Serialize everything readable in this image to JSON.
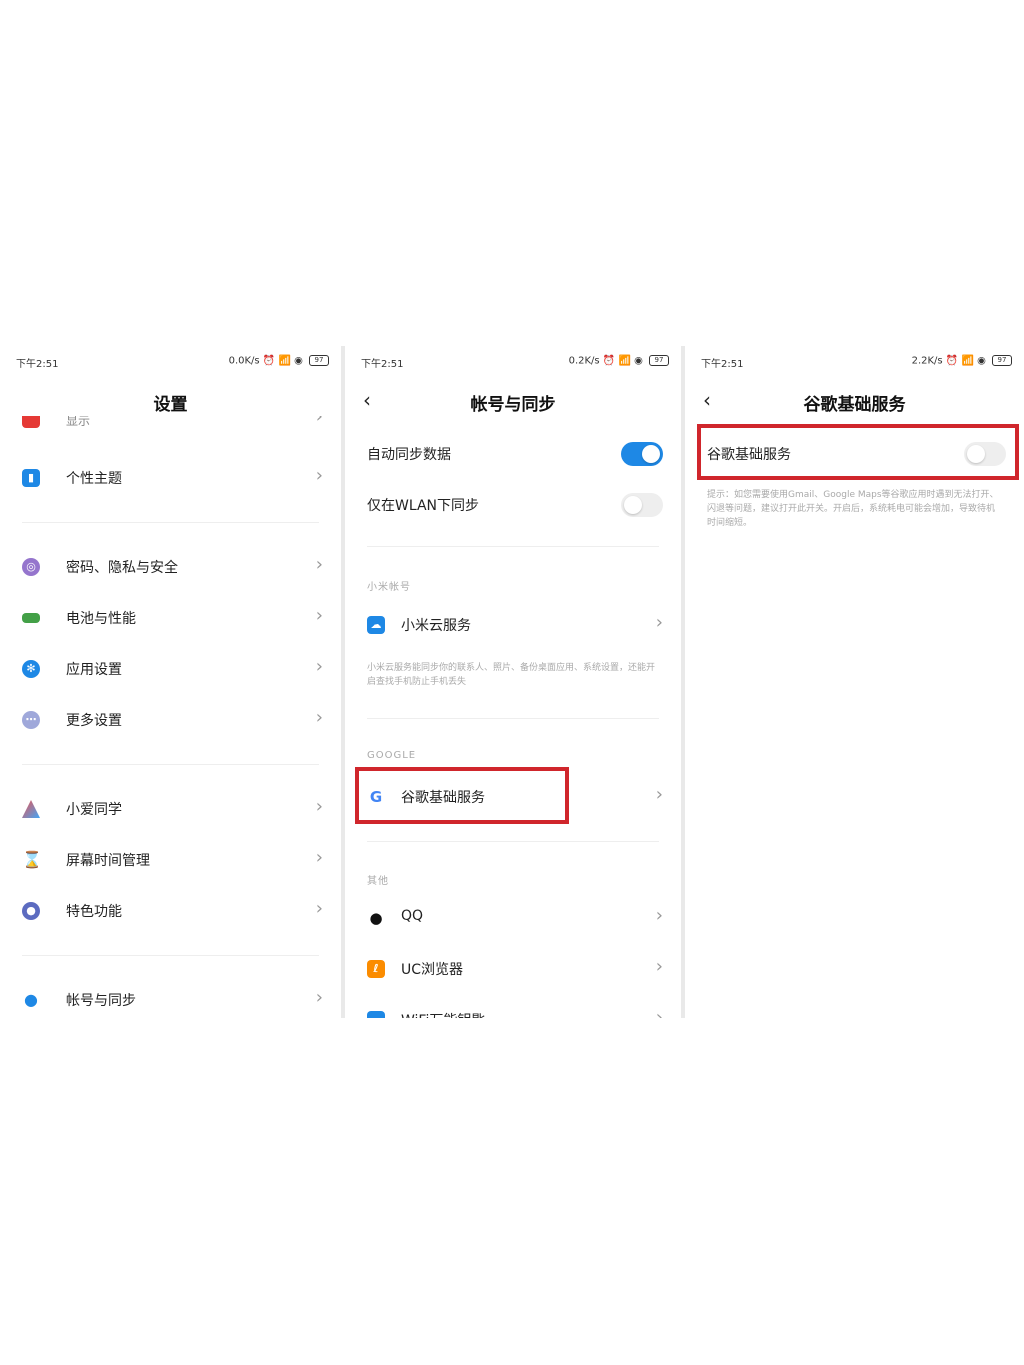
{
  "panels": {
    "settings": {
      "status": {
        "time": "下午2:51",
        "right": "0.0K/s ⏰ 📶 ◉",
        "battery": "97"
      },
      "title": "设置",
      "partial_top_label": "显示",
      "items": [
        {
          "label": "个性主题",
          "icon": "theme-icon",
          "color": "#1e88e5"
        },
        {
          "label": "密码、隐私与安全",
          "icon": "fingerprint-icon",
          "color": "#7e57c2"
        },
        {
          "label": "电池与性能",
          "icon": "battery-icon",
          "color": "#43a047"
        },
        {
          "label": "应用设置",
          "icon": "gear-icon",
          "color": "#1e88e5"
        },
        {
          "label": "更多设置",
          "icon": "more-icon",
          "color": "#7986cb"
        },
        {
          "label": "小爱同学",
          "icon": "assistant-icon",
          "color": "#5c6bc0"
        },
        {
          "label": "屏幕时间管理",
          "icon": "hourglass-icon",
          "color": "#fbc02d"
        },
        {
          "label": "特色功能",
          "icon": "feature-icon",
          "color": "#5c6bc0"
        },
        {
          "label": "帐号与同步",
          "icon": "account-icon",
          "color": "#1e88e5"
        }
      ]
    },
    "account_sync": {
      "status": {
        "time": "下午2:51",
        "right": "0.2K/s ⏰ 📶 ◉",
        "battery": "97"
      },
      "back": "‹",
      "title": "帐号与同步",
      "auto_sync": {
        "label": "自动同步数据",
        "on": true
      },
      "wlan_only": {
        "label": "仅在WLAN下同步",
        "on": false
      },
      "mi_section": "小米帐号",
      "mi_cloud": {
        "label": "小米云服务",
        "desc": "小米云服务能同步你的联系人、照片、备份桌面应用、系统设置，还能开启查找手机防止手机丢失"
      },
      "google_section": "GOOGLE",
      "google": {
        "label": "谷歌基础服务",
        "icon_letter": "G"
      },
      "other_section": "其他",
      "qq": {
        "label": "QQ"
      },
      "uc": {
        "label": "UC浏览器"
      },
      "partial_bottom_label": "WiFi万能钥匙"
    },
    "google_basic": {
      "status": {
        "time": "下午2:51",
        "right": "2.2K/s ⏰ 📶 ◉",
        "battery": "97"
      },
      "back": "‹",
      "title": "谷歌基础服务",
      "toggle": {
        "label": "谷歌基础服务",
        "on": false
      },
      "hint": "提示：如您需要使用Gmail、Google Maps等谷歌应用时遇到无法打开、闪退等问题，建议打开此开关。开启后，系统耗电可能会增加，导致待机时间缩短。"
    }
  },
  "accent": "#1e88e5",
  "highlight_color": "#d0262c"
}
